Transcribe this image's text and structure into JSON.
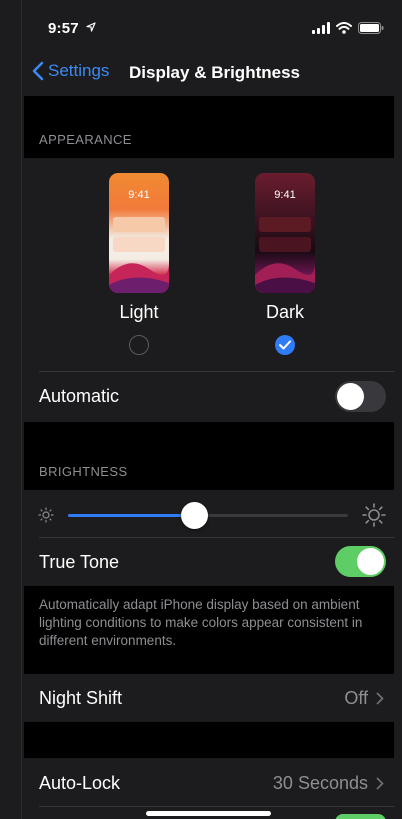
{
  "status": {
    "time": "9:57"
  },
  "nav": {
    "back_label": "Settings",
    "title": "Display & Brightness"
  },
  "appearance": {
    "header": "APPEARANCE",
    "thumb_time": "9:41",
    "options": [
      {
        "label": "Light",
        "selected": false
      },
      {
        "label": "Dark",
        "selected": true
      }
    ],
    "automatic_label": "Automatic",
    "automatic_on": false
  },
  "brightness": {
    "header": "BRIGHTNESS",
    "level": 0.45,
    "true_tone_label": "True Tone",
    "true_tone_on": true,
    "true_tone_footer": "Automatically adapt iPhone display based on ambient lighting conditions to make colors appear consistent in different environments."
  },
  "night_shift": {
    "label": "Night Shift",
    "value": "Off"
  },
  "auto_lock": {
    "label": "Auto-Lock",
    "value": "30 Seconds"
  },
  "colors": {
    "accent": "#2f7cf6",
    "toggle_on": "#5fcd66",
    "back": "#3b8bf5"
  }
}
